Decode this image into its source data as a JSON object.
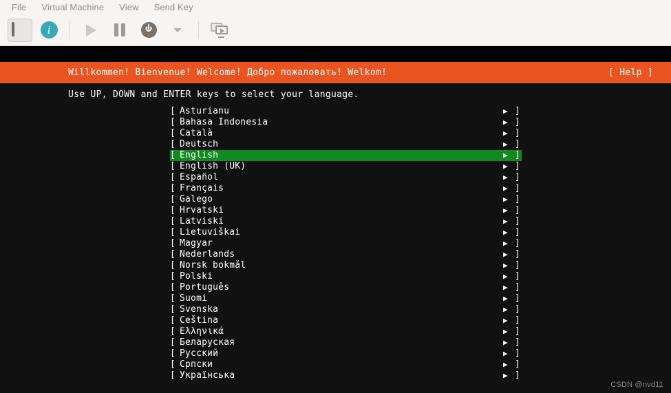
{
  "window": {
    "menubar": [
      {
        "label": "File",
        "name": "menu-file"
      },
      {
        "label": "Virtual Machine",
        "name": "menu-virtual-machine"
      },
      {
        "label": "View",
        "name": "menu-view"
      },
      {
        "label": "Send Key",
        "name": "menu-send-key"
      }
    ],
    "toolbar": {
      "console_icon": "console-icon",
      "info_icon": "info-icon",
      "run_icon": "play-icon",
      "pause_icon": "pause-icon",
      "shutdown_icon": "power-icon",
      "shutdown_menu_icon": "chevron-down-icon",
      "snapshots_icon": "snapshots-icon",
      "info_glyph": "i"
    }
  },
  "guest": {
    "banner": {
      "greeting": "Willkommen! Bienvenue! Welcome! Добро пожаловать! Welkom!",
      "help": "[ Help ]",
      "background_color": "#e95420"
    },
    "instruction": "Use UP, DOWN and ENTER keys to select your language.",
    "list": {
      "bracket_left": "[",
      "bracket_right": "]",
      "arrow": "▶",
      "selected_index": 4,
      "highlight_color": "#128a22",
      "items": [
        "Asturianu",
        "Bahasa Indonesia",
        "Català",
        "Deutsch",
        "English",
        "English (UK)",
        "Español",
        "Français",
        "Galego",
        "Hrvatski",
        "Latviski",
        "Lietuviškai",
        "Magyar",
        "Nederlands",
        "Norsk bokmål",
        "Polski",
        "Português",
        "Suomi",
        "Svenska",
        "Čeština",
        "Ελληνικά",
        "Беларуская",
        "Русский",
        "Српски",
        "Українська"
      ]
    },
    "watermark": "CSDN @nvd11"
  }
}
